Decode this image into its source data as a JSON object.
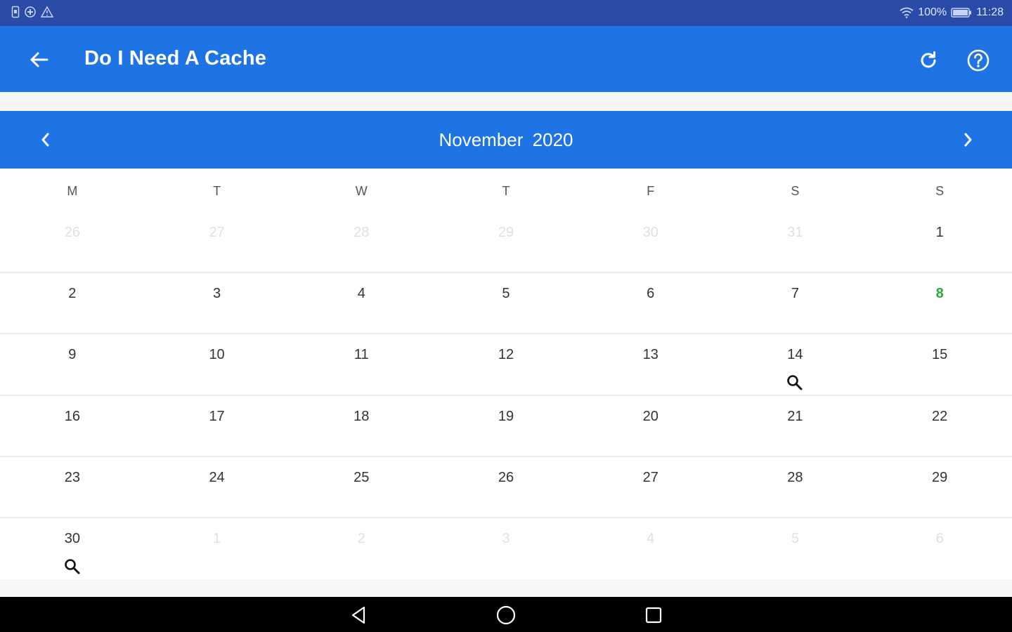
{
  "status_bar": {
    "battery_percent": "100%",
    "time": "11:28",
    "icons_left": [
      "sim-card-icon",
      "gamepad-icon",
      "warning-icon"
    ],
    "icons_right": [
      "wifi-icon",
      "battery-icon"
    ]
  },
  "app_bar": {
    "title": "Do I Need A Cache",
    "back_icon": "arrow-back-icon",
    "actions": [
      "refresh-icon",
      "help-icon"
    ],
    "color": "#1e74e4"
  },
  "calendar": {
    "month_label": "November",
    "year_label": "2020",
    "prev_icon": "chevron-left-icon",
    "next_icon": "chevron-right-icon",
    "weekdays": [
      "M",
      "T",
      "W",
      "T",
      "F",
      "S",
      "S"
    ],
    "colors": {
      "today": "#2eaa3c",
      "outside": "#e0e0e0",
      "normal": "#333333"
    },
    "weeks": [
      [
        {
          "label": "26",
          "outside": true
        },
        {
          "label": "27",
          "outside": true
        },
        {
          "label": "28",
          "outside": true
        },
        {
          "label": "29",
          "outside": true
        },
        {
          "label": "30",
          "outside": true
        },
        {
          "label": "31",
          "outside": true
        },
        {
          "label": "1"
        }
      ],
      [
        {
          "label": "2"
        },
        {
          "label": "3"
        },
        {
          "label": "4"
        },
        {
          "label": "5"
        },
        {
          "label": "6"
        },
        {
          "label": "7"
        },
        {
          "label": "8",
          "today": true
        }
      ],
      [
        {
          "label": "9"
        },
        {
          "label": "10"
        },
        {
          "label": "11"
        },
        {
          "label": "12"
        },
        {
          "label": "13"
        },
        {
          "label": "14",
          "icon": "search-icon"
        },
        {
          "label": "15"
        }
      ],
      [
        {
          "label": "16"
        },
        {
          "label": "17"
        },
        {
          "label": "18"
        },
        {
          "label": "19"
        },
        {
          "label": "20"
        },
        {
          "label": "21"
        },
        {
          "label": "22"
        }
      ],
      [
        {
          "label": "23"
        },
        {
          "label": "24"
        },
        {
          "label": "25"
        },
        {
          "label": "26"
        },
        {
          "label": "27"
        },
        {
          "label": "28"
        },
        {
          "label": "29"
        }
      ],
      [
        {
          "label": "30",
          "icon": "search-icon"
        },
        {
          "label": "1",
          "outside": true
        },
        {
          "label": "2",
          "outside": true
        },
        {
          "label": "3",
          "outside": true
        },
        {
          "label": "4",
          "outside": true
        },
        {
          "label": "5",
          "outside": true
        },
        {
          "label": "6",
          "outside": true
        }
      ]
    ]
  },
  "nav_bar": {
    "buttons": [
      "nav-back-icon",
      "nav-home-icon",
      "nav-recents-icon"
    ]
  }
}
